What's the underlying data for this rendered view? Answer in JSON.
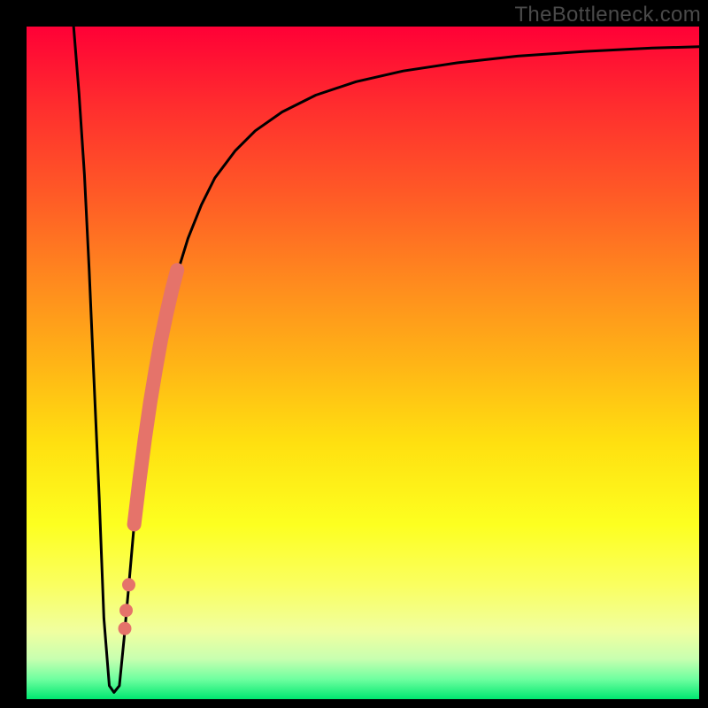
{
  "watermark": "TheBottleneck.com",
  "chart_data": {
    "type": "line",
    "title": "",
    "xlabel": "",
    "ylabel": "",
    "xlim": [
      0,
      100
    ],
    "ylim": [
      0,
      100
    ],
    "series": [
      {
        "name": "bottleneck-curve",
        "color": "#000000",
        "x": [
          7.0,
          7.8,
          8.6,
          9.3,
          10.0,
          10.8,
          11.5,
          12.3,
          13.0,
          13.8,
          14.5,
          15.3,
          16.0,
          17.5,
          19.0,
          20.5,
          22.0,
          24.0,
          26.0,
          28.0,
          31.0,
          34.0,
          38.0,
          43.0,
          49.0,
          56.0,
          64.0,
          73.0,
          83.0,
          93.0,
          100.0
        ],
        "y": [
          100.0,
          90.0,
          78.0,
          64.0,
          48.0,
          30.0,
          12.0,
          2.0,
          1.0,
          2.0,
          9.0,
          18.0,
          26.0,
          38.0,
          48.0,
          56.0,
          62.0,
          68.5,
          73.5,
          77.5,
          81.5,
          84.5,
          87.3,
          89.8,
          91.8,
          93.4,
          94.6,
          95.6,
          96.3,
          96.8,
          97.0
        ]
      }
    ],
    "markers": {
      "name": "highlight-dots",
      "color": "#e5736a",
      "points": [
        {
          "x": 16.0,
          "y": 26.0
        },
        {
          "x": 16.8,
          "y": 32.7
        },
        {
          "x": 17.6,
          "y": 38.8
        },
        {
          "x": 18.4,
          "y": 44.2
        },
        {
          "x": 19.2,
          "y": 49.0
        },
        {
          "x": 20.0,
          "y": 53.5
        },
        {
          "x": 20.8,
          "y": 57.3
        },
        {
          "x": 21.6,
          "y": 60.8
        },
        {
          "x": 22.4,
          "y": 63.8
        }
      ],
      "sparse_points": [
        {
          "x": 15.2,
          "y": 17.0
        },
        {
          "x": 14.6,
          "y": 10.5
        },
        {
          "x": 14.8,
          "y": 13.2
        }
      ]
    }
  }
}
